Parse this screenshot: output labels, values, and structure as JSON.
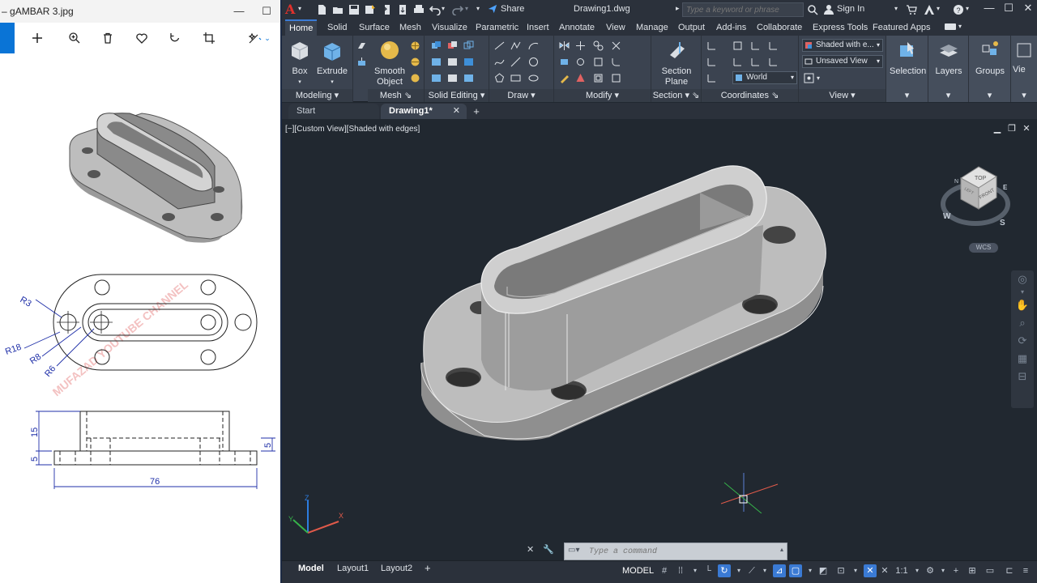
{
  "viewer": {
    "title": "gAMBAR 3.jpg",
    "title_prefix": "–",
    "image": {
      "dim_r3": "R3",
      "dim_r18": "R18",
      "dim_r8": "R8",
      "dim_r6": "R6",
      "dim_15": "15",
      "dim_5a": "5",
      "dim_5b": "5",
      "dim_76": "76",
      "watermark": "MUFAZAD YOUTUBE CHANNEL"
    }
  },
  "acad": {
    "logo": "A",
    "share_label": "Share",
    "doc_title": "Drawing1.dwg",
    "search_placeholder": "Type a keyword or phrase",
    "signin_label": "Sign In",
    "menu_tabs": [
      "Home",
      "Solid",
      "Surface",
      "Mesh",
      "Visualize",
      "Parametric",
      "Insert",
      "Annotate",
      "View",
      "Manage",
      "Output",
      "Add-ins",
      "Collaborate",
      "Express Tools",
      "Featured Apps"
    ],
    "ribbon": {
      "box_label": "Box",
      "extrude_label": "Extrude",
      "smooth_label_1": "Smooth",
      "smooth_label_2": "Object",
      "section_plane_1": "Section",
      "section_plane_2": "Plane",
      "visual_style": "Shaded with e...",
      "saved_view": "Unsaved View",
      "ucs_world": "World",
      "selection_label": "Selection",
      "layers_label": "Layers",
      "groups_label": "Groups",
      "view_label_cut": "Vie",
      "panels": [
        "Modeling",
        "Mesh",
        "Solid Editing",
        "Draw",
        "Modify",
        "Section",
        "Coordinates",
        "View"
      ]
    },
    "file_tabs": {
      "start": "Start",
      "active": "Drawing1*"
    },
    "viewport": {
      "label": "[−][Custom View][Shaded with edges]",
      "viewcube": {
        "top": "TOP",
        "front": "FRONT",
        "left": "LEFT",
        "north": "N",
        "south": "S",
        "east": "E",
        "west": "W"
      },
      "wcs": "WCS"
    },
    "command_placeholder": "Type a command",
    "layout_tabs": [
      "Model",
      "Layout1",
      "Layout2"
    ],
    "status": {
      "model": "MODEL",
      "scale": "1:1"
    }
  }
}
